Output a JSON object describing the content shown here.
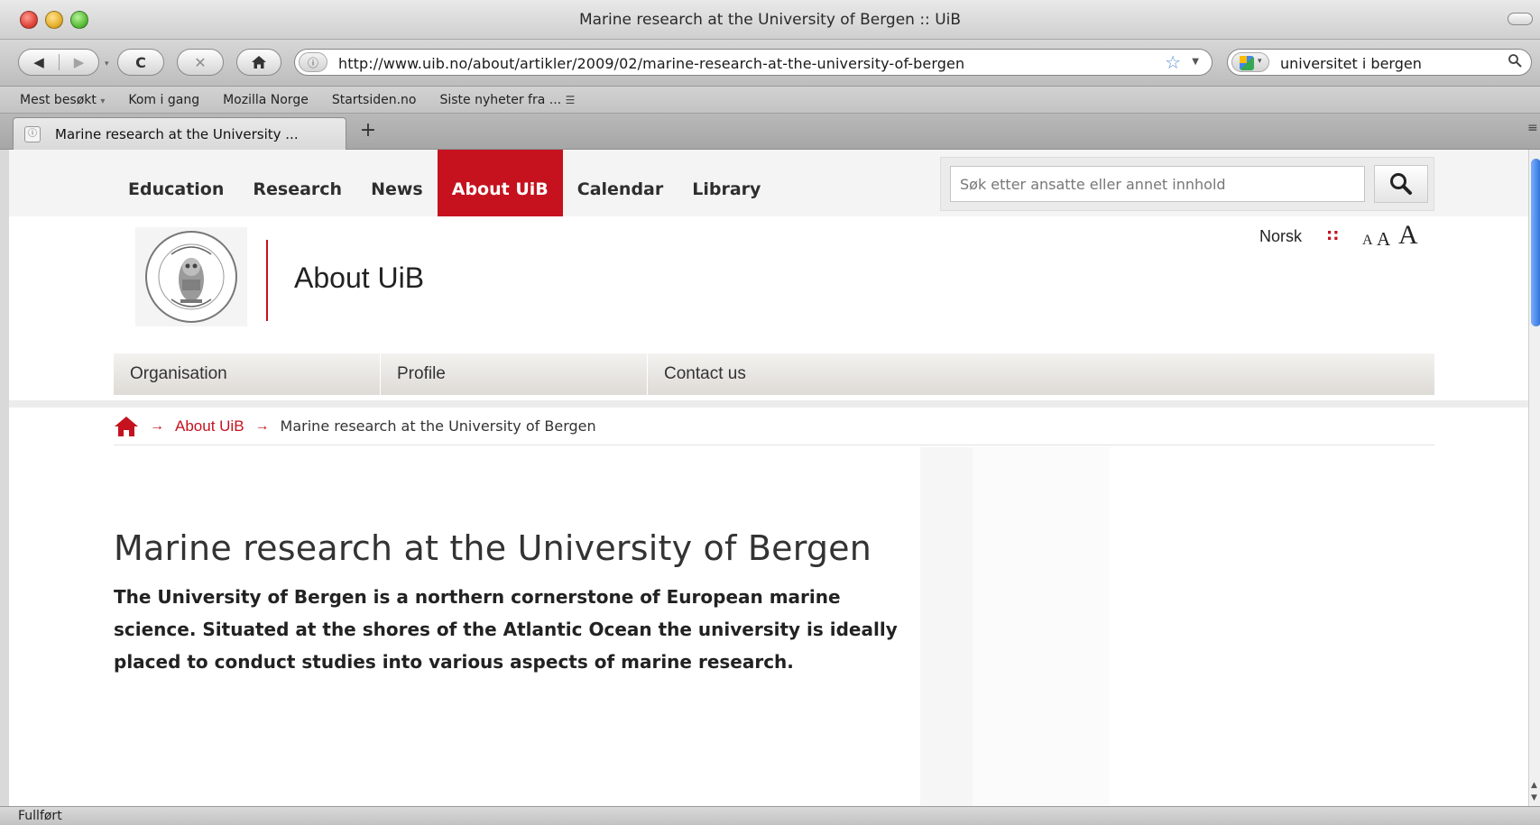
{
  "window": {
    "title": "Marine research at the University of Bergen :: UiB"
  },
  "toolbar": {
    "url": "http://www.uib.no/about/artikler/2009/02/marine-research-at-the-university-of-bergen",
    "search_value": "universitet i bergen"
  },
  "bookmarks": [
    "Mest besøkt",
    "Kom i gang",
    "Mozilla Norge",
    "Startsiden.no",
    "Siste nyheter fra ..."
  ],
  "tab": {
    "label": "Marine research at the University ..."
  },
  "site": {
    "nav": [
      "Education",
      "Research",
      "News",
      "About UiB",
      "Calendar",
      "Library"
    ],
    "active_nav": "About UiB",
    "search_placeholder": "Søk etter ansatte eller annet innhold",
    "language_link": "Norsk",
    "language_separator": "::",
    "font_sizes": [
      "A",
      "A",
      "A"
    ],
    "section_title": "About UiB",
    "subnav": [
      "Organisation",
      "Profile",
      "Contact us"
    ],
    "breadcrumb": {
      "separator": "→",
      "link": "About UiB",
      "current": "Marine research at the University of Bergen"
    }
  },
  "article": {
    "title": "Marine research at the University of Bergen",
    "lead": "The University of Bergen is a northern cornerstone of European marine science. Situated at the shores of the Atlantic Ocean the university is ideally placed to conduct studies into various aspects of marine research."
  },
  "status": {
    "text": "Fullført"
  },
  "colors": {
    "accent": "#c5121e",
    "scroll_thumb": "#2c6fd9"
  },
  "icons": {
    "back": "back-arrow-icon",
    "forward": "forward-arrow-icon",
    "reload": "reload-icon",
    "stop": "stop-icon",
    "home": "home-icon",
    "bookmark": "star-icon",
    "search": "magnifier-icon",
    "rss": "rss-icon",
    "breadcrumb_home": "home-icon"
  }
}
